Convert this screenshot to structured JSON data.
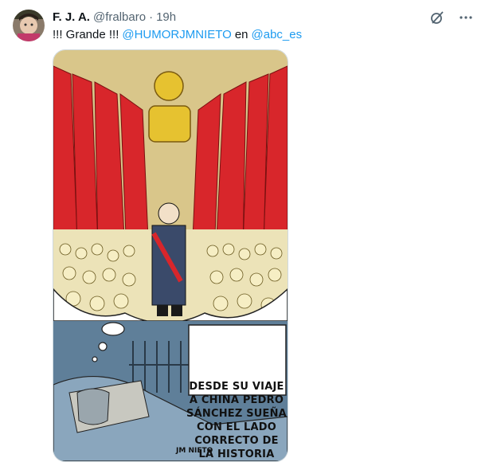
{
  "tweet": {
    "author_name": "F. J. A.",
    "handle": "@fralbaro",
    "separator": "·",
    "time": "19h",
    "text_prefix": "!!! Grande !!!",
    "mention_1": "@HUMORJMNIETO",
    "text_mid": "en",
    "mention_2": "@abc_es"
  },
  "cartoon": {
    "caption": "DESDE SU VIAJE A CHINA PEDRO SÁNCHEZ SUEÑA CON EL LADO CORRECTO DE LA HISTORIA",
    "signature": "JM NIETO"
  },
  "icons": [
    "grok-icon",
    "more-icon"
  ],
  "colors": {
    "link": "#1d9bf0",
    "text": "#0f1419",
    "muted": "#536471"
  }
}
